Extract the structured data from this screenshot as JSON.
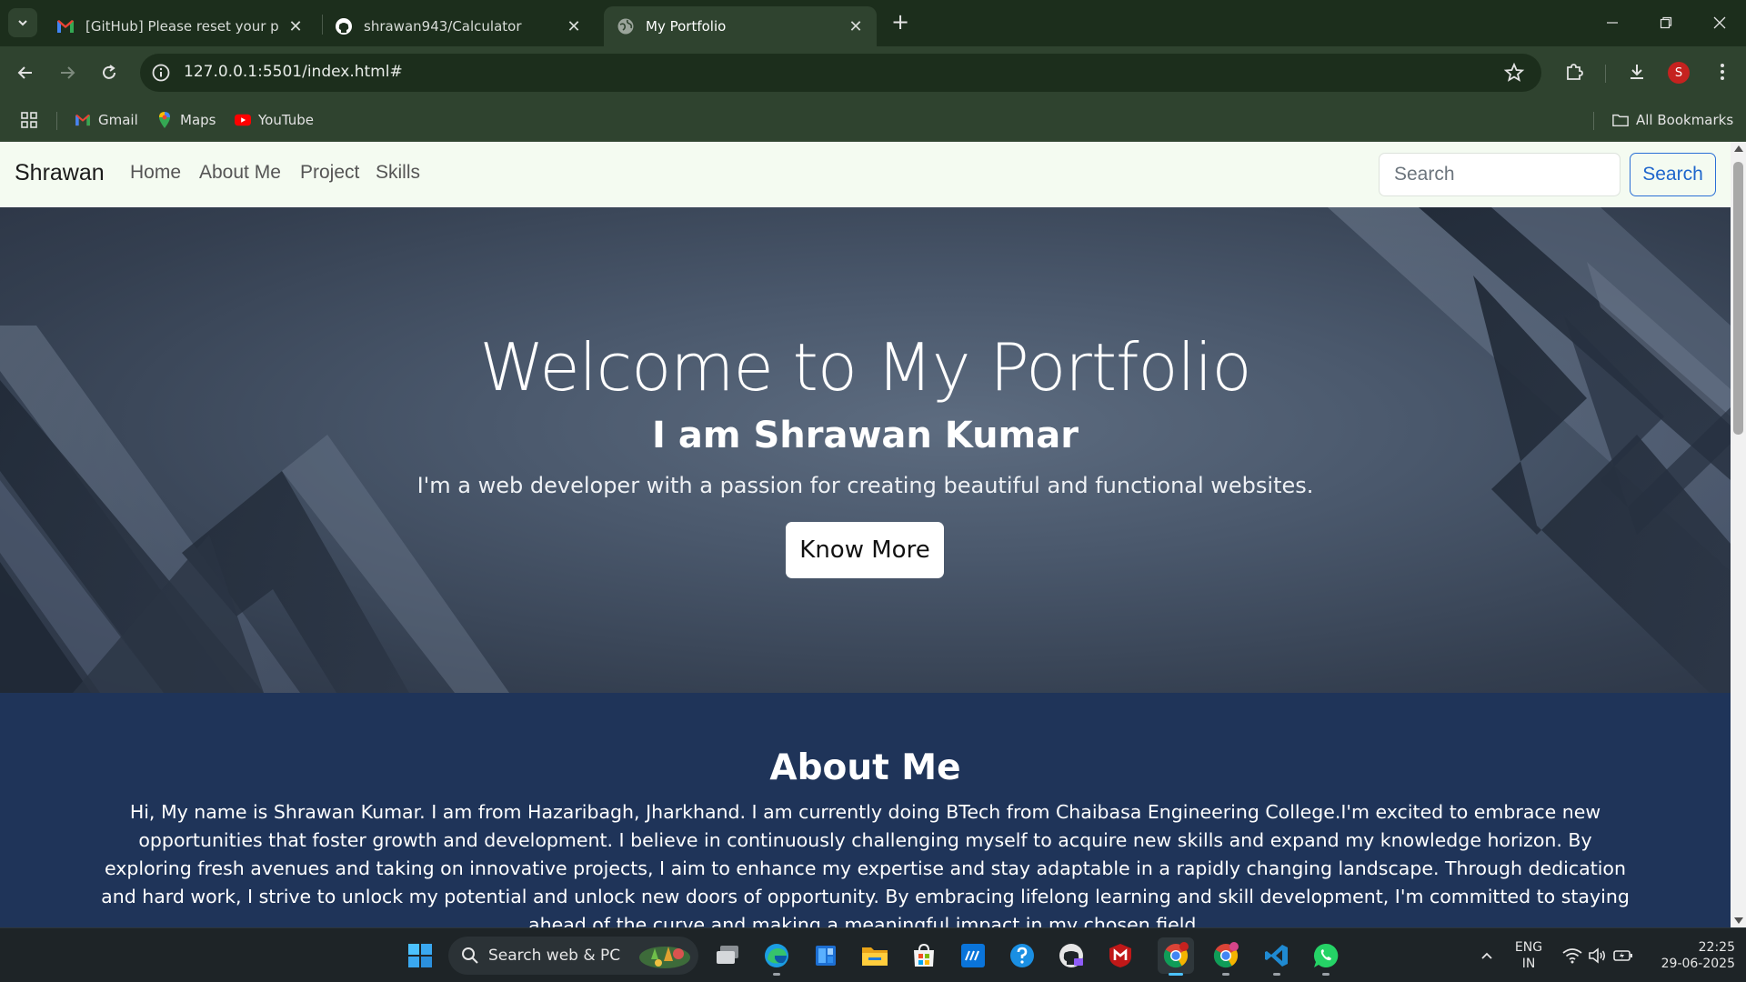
{
  "browser": {
    "tabs": [
      {
        "title": "[GitHub] Please reset your password",
        "favicon": "gmail-icon"
      },
      {
        "title": "shrawan943/Calculator",
        "favicon": "github-icon"
      },
      {
        "title": "My Portfolio",
        "favicon": "globe-icon",
        "active": true
      }
    ],
    "url": "127.0.0.1:5501/index.html#",
    "profile_initial": "S",
    "bookmarks": [
      {
        "label": "Gmail",
        "icon": "gmail-icon"
      },
      {
        "label": "Maps",
        "icon": "maps-icon"
      },
      {
        "label": "YouTube",
        "icon": "youtube-icon"
      }
    ],
    "all_bookmarks_label": "All Bookmarks"
  },
  "site": {
    "brand": "Shrawan",
    "nav_links": [
      "Home",
      "About Me",
      "Project",
      "Skills"
    ],
    "search_placeholder": "Search",
    "search_button": "Search"
  },
  "hero": {
    "title": "Welcome to My Portfolio",
    "subtitle": "I am Shrawan Kumar",
    "text": "I'm a web developer with a passion for creating beautiful and functional websites.",
    "button": "Know More"
  },
  "about": {
    "title": "About Me",
    "text": "Hi, My name is Shrawan Kumar. I am from Hazaribagh, Jharkhand. I am currently doing BTech from Chaibasa Engineering College.I'm excited to embrace new opportunities that foster growth and development. I believe in continuously challenging myself to acquire new skills and expand my knowledge horizon. By exploring fresh avenues and taking on innovative projects, I aim to enhance my expertise and stay adaptable in a rapidly changing landscape. Through dedication and hard work, I strive to unlock my potential and unlock new doors of opportunity. By embracing lifelong learning and skill development, I'm committed to staying ahead of the curve and making a meaningful impact in my chosen field."
  },
  "taskbar": {
    "search_label": "Search web & PC",
    "apps": [
      "windows-start-icon",
      "task-view-icon",
      "edge-icon",
      "widgets-icon",
      "file-explorer-icon",
      "microsoft-store-icon",
      "myhp-icon",
      "help-icon",
      "github-desktop-icon",
      "mcafee-icon",
      "chrome-icon",
      "chrome-profile-icon",
      "vscode-icon",
      "whatsapp-icon"
    ],
    "lang_line1": "ENG",
    "lang_line2": "IN",
    "time": "22:25",
    "date": "29-06-2025"
  },
  "colors": {
    "chrome_dark": "#1c2e1c",
    "chrome_toolbar": "#2f432f",
    "site_nav_bg": "#f4fbf1",
    "about_bg": "#1f3459",
    "search_button": "#1f66cc"
  }
}
